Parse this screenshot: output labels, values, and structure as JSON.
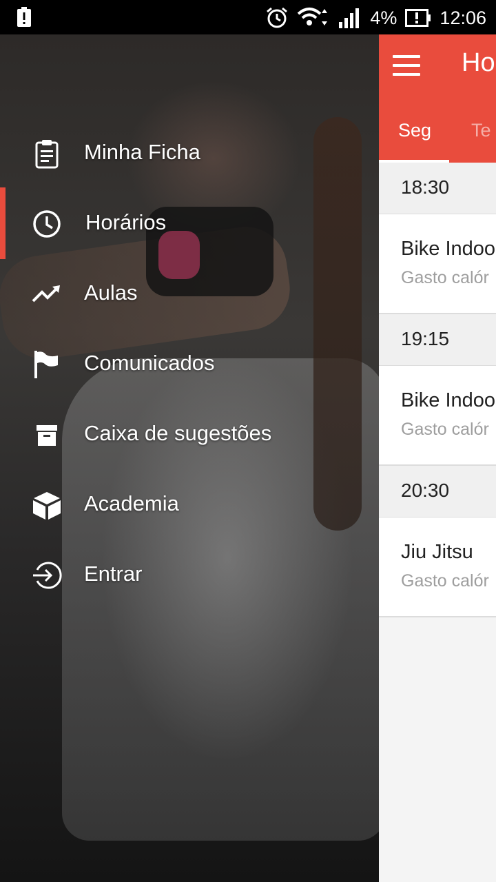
{
  "status_bar": {
    "battery_percent": "4%",
    "time": "12:06",
    "icons": [
      "notification-alert-icon",
      "alarm-icon",
      "wifi-icon",
      "signal-icon",
      "battery-icon"
    ]
  },
  "app": {
    "title": "Ho",
    "tabs": [
      {
        "label": "Seg",
        "selected": true
      },
      {
        "label": "Te",
        "selected": false
      }
    ],
    "schedule": [
      {
        "time": "18:30",
        "class_name": "Bike Indoo",
        "subtitle": "Gasto calór"
      },
      {
        "time": "19:15",
        "class_name": "Bike Indoo",
        "subtitle": "Gasto calór"
      },
      {
        "time": "20:30",
        "class_name": "Jiu Jitsu",
        "subtitle": "Gasto calór"
      }
    ]
  },
  "drawer": {
    "items": [
      {
        "label": "Minha Ficha",
        "icon": "clipboard-icon",
        "selected": false
      },
      {
        "label": "Horários",
        "icon": "clock-icon",
        "selected": true
      },
      {
        "label": "Aulas",
        "icon": "trending-up-icon",
        "selected": false
      },
      {
        "label": "Comunicados",
        "icon": "flag-icon",
        "selected": false
      },
      {
        "label": "Caixa de sugestões",
        "icon": "archive-box-icon",
        "selected": false
      },
      {
        "label": "Academia",
        "icon": "cube-icon",
        "selected": false
      },
      {
        "label": "Entrar",
        "icon": "login-icon",
        "selected": false
      }
    ]
  },
  "colors": {
    "accent": "#e94c3d",
    "background": "#f4f4f4"
  }
}
